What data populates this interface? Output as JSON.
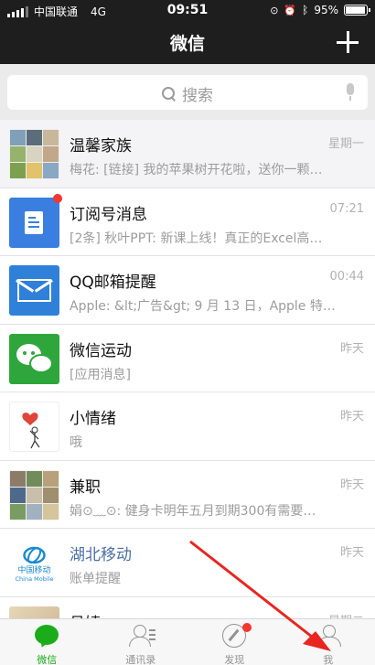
{
  "status_bar": {
    "carrier": "中国联通",
    "network": "4G",
    "time": "09:51",
    "battery": "95%",
    "battery_level": 0.95
  },
  "nav": {
    "title": "微信",
    "add_icon": "plus-icon"
  },
  "search": {
    "placeholder": "搜索",
    "icon": "search-icon",
    "voice_icon": "mic-icon"
  },
  "chats": [
    {
      "name": "温馨家族",
      "time": "星期一",
      "preview": "梅花: [链接] 我的苹果树开花啦，送你一颗…",
      "avatar": "group-photo-grid",
      "pinned": true
    },
    {
      "name": "订阅号消息",
      "time": "07:21",
      "preview": "[2条] 秋叶PPT: 新课上线！真正的Excel高…",
      "avatar": "subscription-icon",
      "unread": true
    },
    {
      "name": "QQ邮箱提醒",
      "time": "00:44",
      "preview": "Apple: &lt;广告&gt; 9 月 13 日，Apple 特…",
      "avatar": "mail-icon"
    },
    {
      "name": "微信运动",
      "time": "昨天",
      "preview": "[应用消息]",
      "avatar": "wechat-sport-icon"
    },
    {
      "name": "小情绪",
      "time": "昨天",
      "preview": "哦",
      "avatar": "heart-sketch-avatar"
    },
    {
      "name": "兼职",
      "time": "昨天",
      "preview": "娟⊙﹏⊙: 健身卡明年五月到期300有需要…",
      "avatar": "group-photo-grid"
    },
    {
      "name": "湖北移动",
      "time": "昨天",
      "preview": "账单提醒",
      "avatar": "china-mobile-logo",
      "official": true
    },
    {
      "name": "吕婧",
      "time": "星期二",
      "preview": "",
      "avatar": "photo-avatar"
    }
  ],
  "logos": {
    "china_mobile_cn": "中国移动",
    "china_mobile_en": "China Mobile"
  },
  "tabs": [
    {
      "label": "微信",
      "icon": "chat-icon",
      "active": true
    },
    {
      "label": "通讯录",
      "icon": "contacts-icon"
    },
    {
      "label": "发现",
      "icon": "discover-icon",
      "badge": true
    },
    {
      "label": "我",
      "icon": "me-icon"
    }
  ],
  "colors": {
    "nav_bg": "#1e1e1e",
    "brand_green": "#1aad19",
    "badge_red": "#f43530",
    "annotation_red": "#e8251f"
  }
}
